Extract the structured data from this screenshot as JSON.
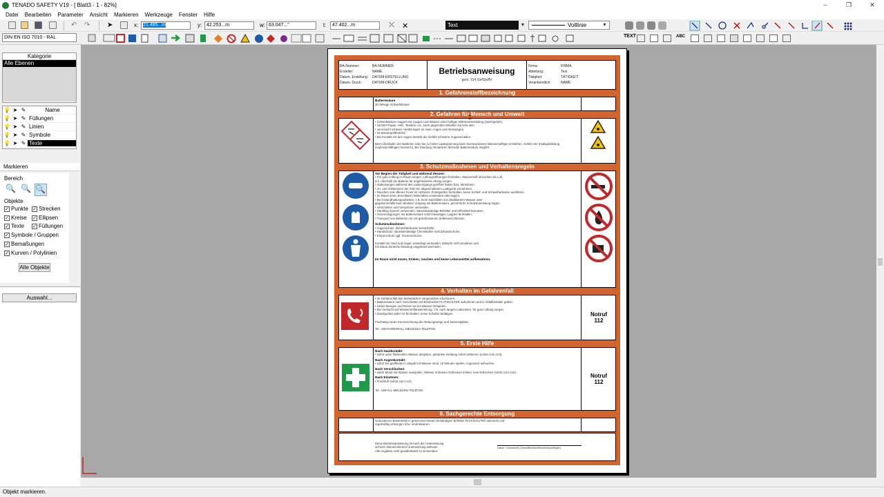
{
  "app": {
    "title": "TENADO SAFETY V19 - [ Blatt3 - 1 - 82%]",
    "window_controls": [
      "–",
      "❐",
      "✕"
    ]
  },
  "menu": [
    "Datei",
    "Bearbeiten",
    "Parameter",
    "Ansicht",
    "Markieren",
    "Werkzeuge",
    "Fenster",
    "Hilfe"
  ],
  "coords": {
    "x_label": "x:",
    "x": "21.485...m",
    "y_label": "y:",
    "y": "42.253...m",
    "w_label": "w:",
    "w": "63.047...\"",
    "l_label": "l:",
    "l": "47.402...m"
  },
  "style": {
    "text_style": "Text",
    "line_style": "Volllinie",
    "norm": "DIN EN ISO 7010 - RAL"
  },
  "left": {
    "kategorie_title": "Kategorie",
    "kategorie_selected": "Alle Ebenen",
    "layer_header": "Name",
    "layers": [
      "Füllungen",
      "Linien",
      "Symbole",
      "Texte"
    ],
    "markieren_title": "Markieren",
    "bereich": "Bereich",
    "objekte": "Objekte",
    "options": [
      "Punkte",
      "Strecken",
      "Kreise",
      "Ellipsen",
      "Texte",
      "Füllungen",
      "Symbole / Gruppen",
      "Bemaßungen",
      "Kurven / Polylinien"
    ],
    "alle_objekte": "Alle Objekte",
    "auswahl": "Auswahl..."
  },
  "status": "Objekt markieren.",
  "doc": {
    "title": "Betriebsanweisung",
    "subtitle": "gem. §14 GefStoffV",
    "left_meta": [
      [
        "BA-Nummer:",
        "BA-NUMMER"
      ],
      [
        "Ersteller:",
        "NAME"
      ],
      [
        "Datum, Erstellung:",
        "DATUM-ERSTELLUNG"
      ],
      [
        "Datum, Druck:",
        "DATUM-DRUCK"
      ]
    ],
    "right_meta": [
      [
        "Firma:",
        "FIRMA"
      ],
      [
        "Abteilung:",
        "Text"
      ],
      [
        "Tätigkeit:",
        "TÄTIGKEIT"
      ],
      [
        "Verantwortlich:",
        "NAME"
      ]
    ],
    "s1": "1. Gefahrenstoffbezeichnung",
    "s1_name": "Batteriesäure",
    "s1_sub": "30-38%ige Schwefelsäure",
    "s2": "2. Gefahren für Mensch und Umwelt",
    "s2_lines": [
      "• Schwefelsäure reagiert mit Laugen und Wasser unter heftiger Wärmeentwicklung (Spritzgefahr),",
      "• zerstört Papier, Holz, Textilien u.ä., kann gegenüber Metallen korrosiv sein.",
      "• verursacht schwere Verätzungen an Haut, Augen und Atemwegen,",
      "• ist wassergefährdend.",
      "• Bei Kontakt mit den Augen besteht die Gefahr schwerer Augenschäden."
    ],
    "s2_extra": "Beim Überladen der Batterien oder bei zu hoher Ladespannung kann hochexplosives Wasserstoffgas entstehen. Gefahr der Knallgasbildung (explosionsfähiges Gemisch). Bei Zündung Verspritzen ätzender Batteriesäure möglich.",
    "s3": "3. Schutzmaßnahmen und Verhaltensregeln",
    "s3_head": "Vor Beginn der Tätigkeit und während dessen:",
    "s3_lines": [
      "• Für gute Lüftung im Raum sorgen, Lüftungsöffnungen freihalten. Wasserstoff ist leichter als Luft,",
      "  d.h. oberhalb der Batterie für ungehinderten Abzug sorgen.",
      "• Abdeckungen während des Ladevorgangs geöffnet halten bzw. abnehmen.",
      "• An- und Abklemmen der Pole bei abgeschaltetem Ladegerät vornehmen.",
      "• Rauchen und offenes Feuer ist verboten. Zündquellen fernhalten, keine Schleif- und Schweißarbeiten ausführen.",
      "• Im Raum keine brennbaren Materialien verwenden oder lagern.",
      "• Bei Instandhaltungsarbeiten, z.B. beim Nachfüllen von destilliertem Wasser oder",
      "  gegebenenfalls beim direkten Umgang mit Batteriesäure, persönliche Schutzausrüstung tragen.",
      "• Verschütten und Verspritzen vermeiden.",
      "• Handling-System verwenden; Säurebeständige Behälter und Hilfsmittel benutzen.",
      "• Verunreinigungen mit Batteriesäure sofort beseitigen; Lappen fernhalten.",
      "• Transport von Batterien nur mit geschlossenen Zellenverschlüssen."
    ],
    "s3_ps_head": "Schutzmaßnahmen:",
    "s3_ps": [
      "• Augenschutz: dichtschließende Schutzbrille,",
      "• Handschutz: säurebeständige Chemikalien-Schutzhandschuhe,",
      "• Körperschutz: ggf. Gummischürze."
    ],
    "s3_note": [
      "Kontakt mit Haut und Augen unbedingt vermeiden. Dämpfe nicht einatmen und",
      "mit Säure benetzte Kleidung umgehend wechseln."
    ],
    "s3_bold": "Im Raum nicht essen, trinken, rauchen und keine Lebensmittel aufbewahren.",
    "s4": "4. Verhalten im Gefahrenfall",
    "s4_lines": [
      "• Im Gefahrenfall den betrieblichen Vorgesetzten informieren.",
      "• Batteriesäure nach Verschütten mit Bindemittel PLATZHALTER aufnehmen und in Abfallbehälter geben.",
      "• Kleine Mengen und Reste mit viel Wasser fortspülen.",
      "• Bei Verdacht auf Wasserstoffansammlung, z.B. nach langen Ladezeiten, für gute Lüftung sorgen.",
      "• Zündquellen jeder Art fernhalten, keine Schalter betätigen."
    ],
    "s4_note": "Fluchtweg sowie Kennzeichnung der Rettungswege und Sammelplätze.",
    "s4_tel": "Tel.: GEFAHRENFALL-MELDUNG-TELEFON",
    "notruf_label": "Notruf",
    "notruf_num": "112",
    "s5": "5. Erste Hilfe",
    "s5_blocks": [
      [
        "Nach Hautkontakt:",
        "• sofort unter fließendem Wasser abspülen, getränkte Kleidung sofort entfernen (sofort zum Arzt)."
      ],
      [
        "Nach Augenkontakt:",
        "• sofort bei geöffnetem Lidspalt mit Wasser mind. 10 Minuten spülen, Augenarzt aufsuchen."
      ],
      [
        "Nach Verschlucken:",
        "• sofort Mund mit Wasser ausspülen, Wasser in kleinen Schlucken trinken, kein Erbrechen (sofort zum Arzt)."
      ],
      [
        "Nach Einatmen:",
        "• Frischluft (sofort zum Arzt)."
      ]
    ],
    "s5_tel": "Tel.: UNFALL-MELDUNG-TELEFON",
    "s6": "6. Sachgerechte Entsorgung",
    "s6_lines": [
      "Gebundenes Bindemittel in gekennzeichneten beständigen Behälter PLATZHALTER sammeln und",
      "regelmäßig entsorgen bzw. neutralisieren."
    ],
    "footer_left": [
      "Diese Betriebsanweisung ist nach der Unterweisung",
      "sicherer dokumentierten Unterweisung wirksam.",
      "Alle Angaben nicht gewährleistet zu verwenden."
    ],
    "footer_right": "Datum / Unterschrift (Geschäftsführer/Betriebsbeauftragter)"
  },
  "colors": {
    "frame": "#d2652d",
    "accent": "#0078d7",
    "blue_sign": "#1f5aa6",
    "green_sign": "#1e9a4a",
    "red_sign": "#c0282a"
  }
}
